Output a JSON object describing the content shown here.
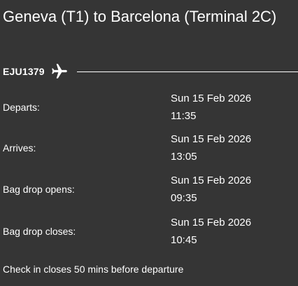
{
  "route": {
    "title": "Geneva (T1) to Barcelona (Terminal 2C)"
  },
  "flight": {
    "number": "EJU1379",
    "icon": "airplane-icon"
  },
  "details": [
    {
      "label": "Departs:",
      "date": "Sun 15 Feb 2026",
      "time": "11:35"
    },
    {
      "label": "Arrives:",
      "date": "Sun 15 Feb 2026",
      "time": "13:05"
    },
    {
      "label": "Bag drop opens:",
      "date": "Sun 15 Feb 2026",
      "time": "09:35"
    },
    {
      "label": "Bag drop closes:",
      "date": "Sun 15 Feb 2026",
      "time": "10:45"
    }
  ],
  "footer": {
    "note": "Check in closes 50 mins before departure"
  },
  "colors": {
    "background": "#353535",
    "text": "#ffffff"
  }
}
